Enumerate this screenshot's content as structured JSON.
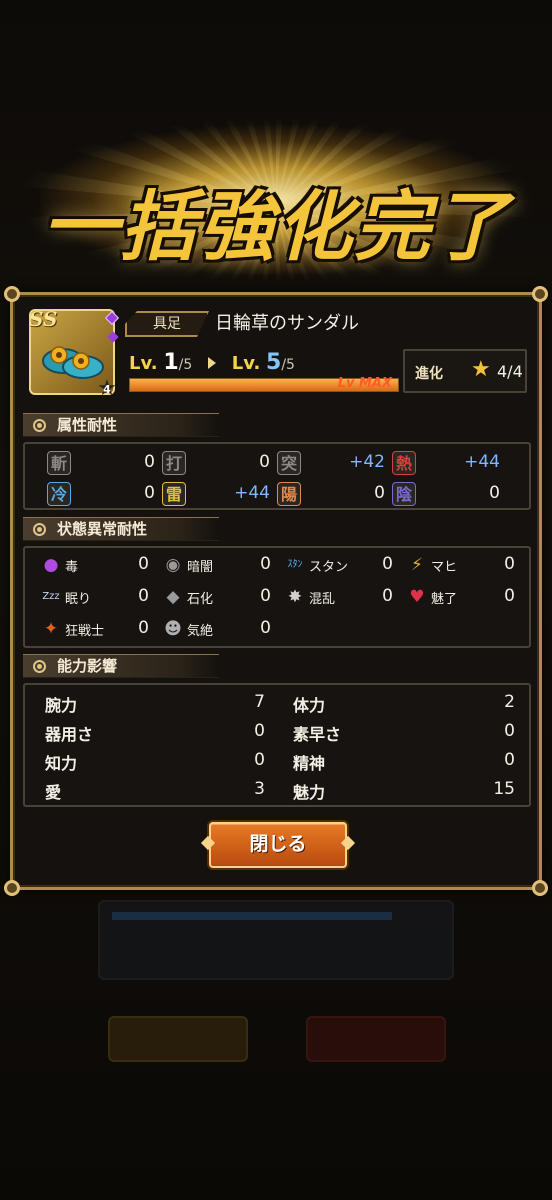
{
  "banner": {
    "title": "一括強化完了"
  },
  "item": {
    "rank": "SS",
    "type": "具足",
    "name": "日輪草のサンダル",
    "star_badge": "4",
    "level": {
      "label": "Lv.",
      "current": "1",
      "current_max": "/5",
      "next": "5",
      "next_max": "/5",
      "bar_fill": 1.0,
      "bar_label": "Lv MAX"
    },
    "evolution": {
      "label": "進化",
      "value": "4/4"
    }
  },
  "attribute_resistance": {
    "title": "属性耐性",
    "rows": [
      [
        {
          "icon": "斬",
          "value": "0",
          "up": false,
          "color": "#8c8a86"
        },
        {
          "icon": "打",
          "value": "0",
          "up": false,
          "color": "#8c8a86"
        },
        {
          "icon": "突",
          "value": "+42",
          "up": true,
          "color": "#8c8a86"
        },
        {
          "icon": "熱",
          "value": "+44",
          "up": true,
          "color": "#d8403a"
        }
      ],
      [
        {
          "icon": "冷",
          "value": "0",
          "up": false,
          "color": "#5aa8e0"
        },
        {
          "icon": "雷",
          "value": "+44",
          "up": true,
          "color": "#e0c040"
        },
        {
          "icon": "陽",
          "value": "0",
          "up": false,
          "color": "#e08a50"
        },
        {
          "icon": "陰",
          "value": "0",
          "up": false,
          "color": "#7a6cc8"
        }
      ]
    ]
  },
  "status_resistance": {
    "title": "状態異常耐性",
    "rows": [
      [
        {
          "icon": "poison-icon",
          "glyph": "●",
          "color": "#b04ae0",
          "label": "毒",
          "value": "0"
        },
        {
          "icon": "darkness-icon",
          "glyph": "◉",
          "color": "#9a9a9a",
          "label": "暗闇",
          "value": "0"
        },
        {
          "icon": "stun-icon",
          "glyph": "ｽﾀﾝ",
          "color": "#5ab0f0",
          "label": "スタン",
          "value": "0"
        },
        {
          "icon": "paralysis-icon",
          "glyph": "⚡",
          "color": "#e0b030",
          "label": "マヒ",
          "value": "0"
        }
      ],
      [
        {
          "icon": "sleep-icon",
          "glyph": "Zzz",
          "color": "#c8d8f0",
          "label": "眠り",
          "value": "0"
        },
        {
          "icon": "petrify-icon",
          "glyph": "◆",
          "color": "#9a9a9a",
          "label": "石化",
          "value": "0"
        },
        {
          "icon": "confusion-icon",
          "glyph": "✸",
          "color": "#d0d0d0",
          "label": "混乱",
          "value": "0"
        },
        {
          "icon": "charm-icon",
          "glyph": "♥",
          "color": "#e0304a",
          "label": "魅了",
          "value": "0"
        }
      ],
      [
        {
          "icon": "berserk-icon",
          "glyph": "✦",
          "color": "#e06020",
          "label": "狂戦士",
          "value": "0"
        },
        {
          "icon": "faint-icon",
          "glyph": "☻",
          "color": "#b0b0b0",
          "label": "気絶",
          "value": "0"
        }
      ]
    ]
  },
  "ability_effect": {
    "title": "能力影響",
    "rows": [
      [
        {
          "label": "腕力",
          "value": "7"
        },
        {
          "label": "体力",
          "value": "2"
        }
      ],
      [
        {
          "label": "器用さ",
          "value": "0"
        },
        {
          "label": "素早さ",
          "value": "0"
        }
      ],
      [
        {
          "label": "知力",
          "value": "0"
        },
        {
          "label": "精神",
          "value": "0"
        }
      ],
      [
        {
          "label": "愛",
          "value": "3"
        },
        {
          "label": "魅力",
          "value": "15"
        }
      ]
    ]
  },
  "close_button": "閉じる"
}
